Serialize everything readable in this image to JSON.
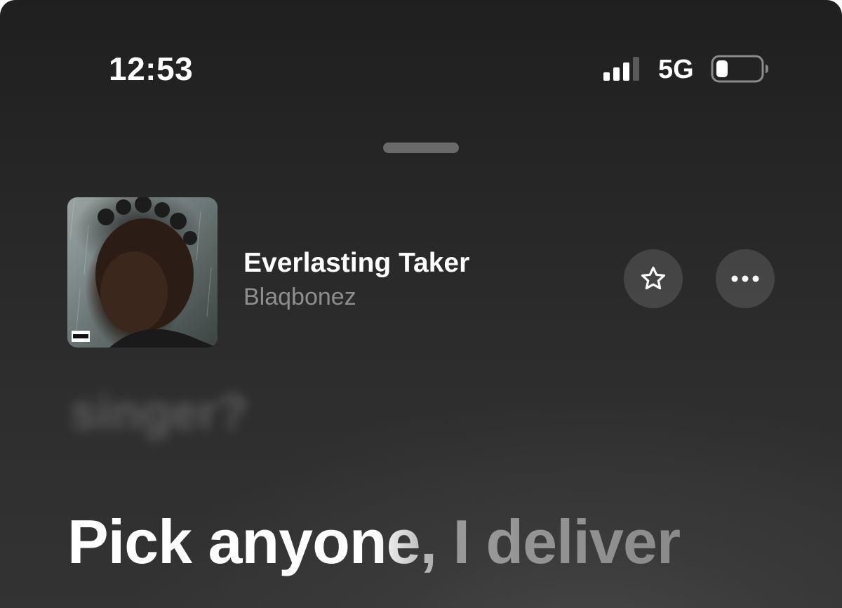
{
  "status_bar": {
    "time": "12:53",
    "network": "5G",
    "signal_icon": "cellular-signal-icon",
    "battery_icon": "battery-low-icon"
  },
  "now_playing": {
    "title": "Everlasting Taker",
    "artist": "Blaqbonez",
    "album_art": "album-art",
    "favorite_icon": "star-icon",
    "more_icon": "ellipsis-icon"
  },
  "lyrics": {
    "previous_line": "singer?",
    "current_line": "Pick anyone, I deliver"
  },
  "colors": {
    "background": "#2a2a2a",
    "text_primary": "#ffffff",
    "text_secondary": "#8e8e8e",
    "button_bg": "#3b3b3b"
  }
}
